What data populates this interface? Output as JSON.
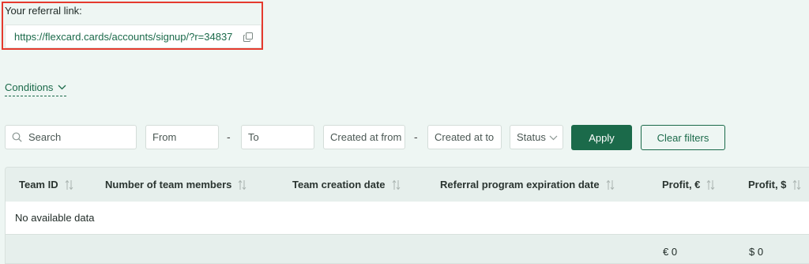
{
  "referral": {
    "label": "Your referral link:",
    "link": "https://flexcard.cards/accounts/signup/?r=34837"
  },
  "conditions": {
    "label": "Conditions"
  },
  "filters": {
    "search_placeholder": "Search",
    "from_placeholder": "From",
    "to_placeholder": "To",
    "created_from_placeholder": "Created at from",
    "created_to_placeholder": "Created at to",
    "status_label": "Status",
    "separator": "-",
    "apply_label": "Apply",
    "clear_label": "Clear filters"
  },
  "table": {
    "columns": [
      "Team ID",
      "Number of team members",
      "Team creation date",
      "Referral program expiration date",
      "Profit, €",
      "Profit, $"
    ],
    "empty_text": "No available data",
    "totals": {
      "eur": "€ 0",
      "usd": "$ 0"
    }
  },
  "colors": {
    "accent": "#1b6a4a",
    "highlight": "#e53a2e",
    "background": "#eef6f3"
  }
}
